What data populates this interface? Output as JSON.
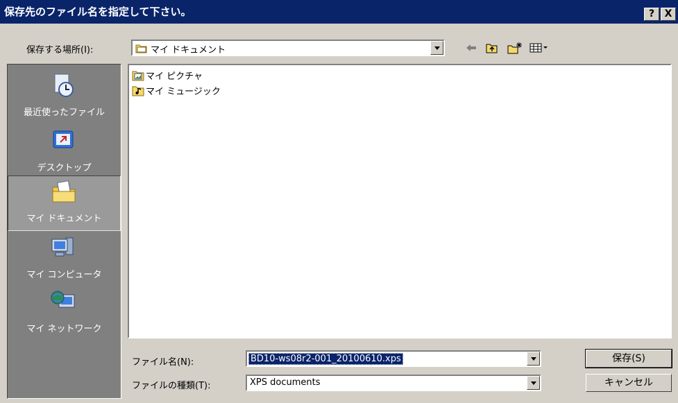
{
  "title": "保存先のファイル名を指定して下さい。",
  "title_buttons": {
    "help": "?",
    "close": "X"
  },
  "look_in": {
    "label": "保存する場所(I):",
    "value": "マイ ドキュメント"
  },
  "toolbar_icons": [
    "back-arrow-icon",
    "up-folder-icon",
    "new-folder-icon",
    "view-menu-icon"
  ],
  "places": [
    {
      "label": "最近使ったファイル",
      "icon": "recent-files-icon"
    },
    {
      "label": "デスクトップ",
      "icon": "desktop-icon"
    },
    {
      "label": "マイ ドキュメント",
      "icon": "my-documents-icon",
      "selected": true
    },
    {
      "label": "マイ コンピュータ",
      "icon": "my-computer-icon"
    },
    {
      "label": "マイ ネットワーク",
      "icon": "my-network-icon"
    }
  ],
  "files": [
    {
      "name": "マイ ピクチャ",
      "icon": "pictures-folder-icon"
    },
    {
      "name": "マイ ミュージック",
      "icon": "music-folder-icon"
    }
  ],
  "filename": {
    "label": "ファイル名(N):",
    "value": "BD10-ws08r2-001_20100610.xps"
  },
  "filetype": {
    "label": "ファイルの種類(T):",
    "value": "XPS documents"
  },
  "buttons": {
    "save": "保存(S)",
    "cancel": "キャンセル"
  },
  "colors": {
    "titlebar": "#0a246a",
    "face": "#d4d0c8",
    "places_bg": "#808080"
  }
}
